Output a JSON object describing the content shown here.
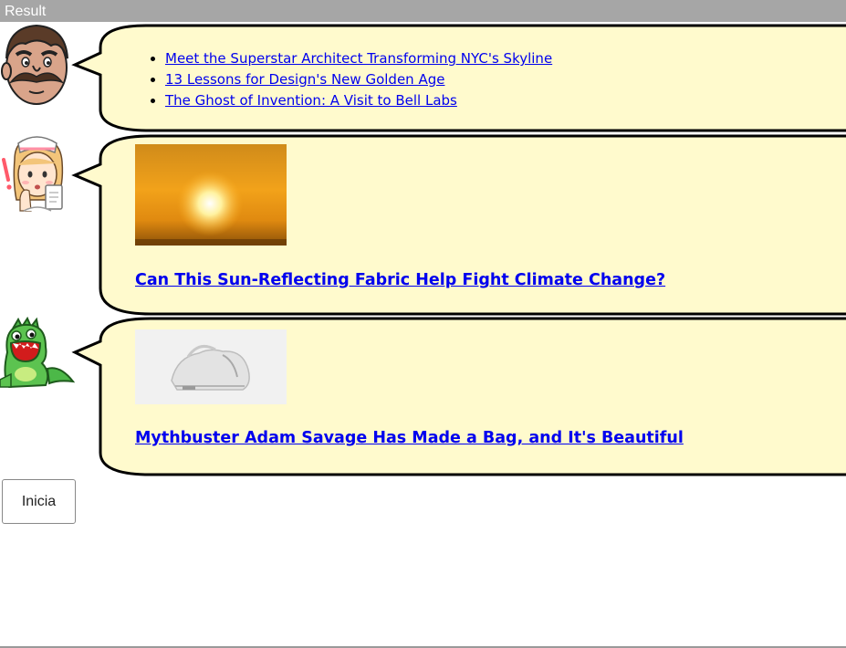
{
  "frame": {
    "title": "Result"
  },
  "feed": {
    "link_list": [
      "Meet the Superstar Architect Transforming NYC's Skyline",
      "13 Lessons for Design's New Golden Age",
      "The Ghost of Invention: A Visit to Bell Labs"
    ],
    "story1": {
      "headline": "Can This Sun-Reflecting Fabric Help Fight Climate Change?",
      "image": "orange-sun-photo"
    },
    "story2": {
      "headline": "Mythbuster Adam Savage Has Made a Bag, and It's Beautiful",
      "image": "white-bag-photo"
    }
  },
  "avatars": [
    "mustache-man-icon",
    "nurse-icon",
    "green-monster-icon"
  ],
  "controls": {
    "start_label": "Inicia"
  },
  "colors": {
    "bubble_fill": "#fffacd",
    "bubble_stroke": "#000000",
    "link": "#0000ee",
    "header_bar": "#a6a6a6"
  }
}
